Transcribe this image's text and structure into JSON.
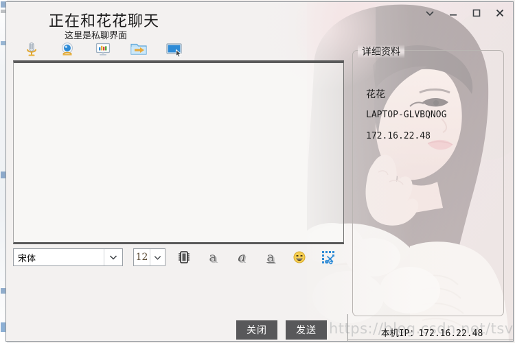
{
  "window": {
    "title": "正在和花花聊天",
    "subtitle": "这里是私聊界面",
    "controls": [
      {
        "name": "chevron-down",
        "label": "⌄"
      },
      {
        "name": "minimize",
        "label": "–"
      },
      {
        "name": "maximize",
        "label": "□"
      },
      {
        "name": "close",
        "label": "×"
      }
    ]
  },
  "toolbar": {
    "items": [
      {
        "name": "microphone-icon",
        "label": "语音"
      },
      {
        "name": "webcam-icon",
        "label": "视频"
      },
      {
        "name": "chart-monitor-icon",
        "label": "远程监控"
      },
      {
        "name": "send-folder-icon",
        "label": "传送文件"
      },
      {
        "name": "screen-share-icon",
        "label": "屏幕共享"
      }
    ]
  },
  "formatbar": {
    "font_family": "宋体",
    "font_size": "12",
    "buttons": [
      {
        "name": "font-dialog-icon",
        "label": "字体"
      },
      {
        "name": "bold-icon",
        "label": "a"
      },
      {
        "name": "italic-icon",
        "label": "a"
      },
      {
        "name": "underline-icon",
        "label": "a"
      },
      {
        "name": "emoji-icon",
        "label": "表情"
      },
      {
        "name": "screenshot-icon",
        "label": "截图"
      }
    ]
  },
  "actions": {
    "close_label": "关闭",
    "send_label": "发送"
  },
  "details": {
    "legend": "详细资料",
    "nickname": "花花",
    "hostname": "LAPTOP-GLVBQNOG",
    "ip": "172.16.22.48"
  },
  "status": {
    "text": "本机IP：172.16.22.48"
  },
  "watermark": {
    "text": "https://blog.csdn.net/tsvico"
  },
  "chat": {
    "messages": []
  },
  "colors": {
    "window_bg": "#f1efee",
    "panel_border": "#5a5a5a",
    "button_bg": "#58585a",
    "button_text": "#ffffff",
    "accent_blue": "#2e8bd6",
    "accent_orange": "#e8a33d",
    "title_text": "#1a1a1a"
  }
}
